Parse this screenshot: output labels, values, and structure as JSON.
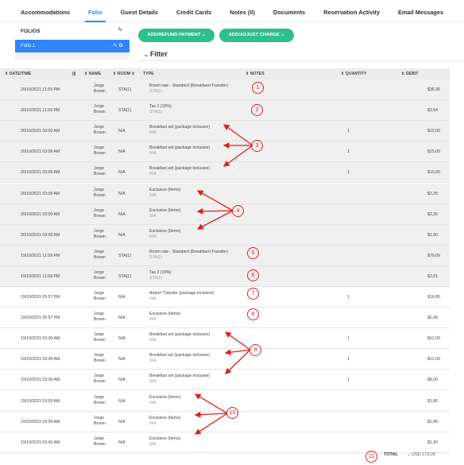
{
  "tabs": [
    {
      "label": "Accommodations",
      "active": false
    },
    {
      "label": "Folio",
      "active": true
    },
    {
      "label": "Guest Details",
      "active": false
    },
    {
      "label": "Credit Cards",
      "active": false
    },
    {
      "label": "Notes (0)",
      "active": false
    },
    {
      "label": "Documents",
      "active": false
    },
    {
      "label": "Reservation Activity",
      "active": false
    },
    {
      "label": "Email Messages",
      "active": false
    }
  ],
  "folios": {
    "title": "FOLIOS",
    "item": "Folio 1"
  },
  "buttons": {
    "refund": "ADD/REFUND PAYMENT",
    "adjust": "ADD/ADJUST CHARGE"
  },
  "filter": "Filter",
  "columns": {
    "datetime": "DATE/TIME",
    "name": "NAME",
    "room": "ROOM",
    "type": "TYPE",
    "notes": "NOTES",
    "quantity": "QUANTITY",
    "debit": "DEBIT"
  },
  "rows": [
    {
      "datetime": "20/10/2021 11:59 PM",
      "name1": "Jorge",
      "name2": "Brown",
      "room": "STA(1)",
      "type": "Room rate - Standard (Breakfast+Transfer)",
      "sub": "STA(1)",
      "qty": "",
      "debit": "$36,36",
      "bg": "grey"
    },
    {
      "datetime": "20/10/2021 11:59 PM",
      "name1": "Jorge",
      "name2": "Brown",
      "room": "STA(1)",
      "type": "Tax 2 (10%)",
      "sub": "STA(1)",
      "qty": "",
      "debit": "$3,64",
      "bg": "grey"
    },
    {
      "datetime": "20/10/2021 03:00 AM",
      "name1": "Jorge",
      "name2": "Brown",
      "room": "N/A",
      "type": "Breakfast set (package inclusive)",
      "sub": "N/A",
      "qty": "1",
      "debit": "$15,00",
      "bg": "grey"
    },
    {
      "datetime": "20/10/2021 03:00 AM",
      "name1": "Jorge",
      "name2": "Brown",
      "room": "N/A",
      "type": "Breakfast set (package inclusive)",
      "sub": "N/A",
      "qty": "1",
      "debit": "$15,00",
      "bg": "grey"
    },
    {
      "datetime": "20/10/2021 03:00 AM",
      "name1": "Jorge",
      "name2": "Brown",
      "room": "N/A",
      "type": "Breakfast set (package inclusive)",
      "sub": "N/A",
      "qty": "1",
      "debit": "$10,00",
      "bg": "grey"
    },
    {
      "datetime": "20/10/2021 03:00 AM",
      "name1": "Jorge",
      "name2": "Brown",
      "room": "N/A",
      "type": "Exclusive (Items)",
      "sub": "N/A",
      "qty": "",
      "debit": "$2,25",
      "bg": "grey"
    },
    {
      "datetime": "20/10/2021 03:00 AM",
      "name1": "Jorge",
      "name2": "Brown",
      "room": "N/A",
      "type": "Exclusive (Items)",
      "sub": "N/A",
      "qty": "",
      "debit": "$2,25",
      "bg": "grey"
    },
    {
      "datetime": "20/10/2021 03:00 AM",
      "name1": "Jorge",
      "name2": "Brown",
      "room": "N/A",
      "type": "Exclusive (Items)",
      "sub": "N/A",
      "qty": "",
      "debit": "$1,50",
      "bg": "grey"
    },
    {
      "datetime": "19/10/2021 11:59 PM",
      "name1": "Jorge",
      "name2": "Brown",
      "room": "STA(1)",
      "type": "Room rate - Standard (Breakfast+Transfer)",
      "sub": "STA(1)",
      "qty": "",
      "debit": "$79,09",
      "bg": "grey"
    },
    {
      "datetime": "19/10/2021 11:59 PM",
      "name1": "Jorge",
      "name2": "Brown",
      "room": "STA(1)",
      "type": "Tax 2 (10%)",
      "sub": "STA(1)",
      "qty": "",
      "debit": "$2,01",
      "bg": "grey"
    },
    {
      "datetime": "19/10/2021 05:57 PM",
      "name1": "Jorge",
      "name2": "Brown",
      "room": "N/A",
      "type": "Airport Transfer (package inclusive)",
      "sub": "N/A",
      "qty": "1",
      "debit": "$16,00",
      "bg": "white"
    },
    {
      "datetime": "19/10/2021 05:57 PM",
      "name1": "Jorge",
      "name2": "Brown",
      "room": "N/A",
      "type": "Exclusive (Items)",
      "sub": "N/A",
      "qty": "",
      "debit": "$2,40",
      "bg": "white"
    },
    {
      "datetime": "19/10/2021 03:00 AM",
      "name1": "Jorge",
      "name2": "Brown",
      "room": "N/A",
      "type": "Breakfast set (package inclusive)",
      "sub": "N/A",
      "qty": "1",
      "debit": "$12,00",
      "bg": "white"
    },
    {
      "datetime": "19/10/2021 03:00 AM",
      "name1": "Jorge",
      "name2": "Brown",
      "room": "N/A",
      "type": "Breakfast set (package inclusive)",
      "sub": "N/A",
      "qty": "1",
      "debit": "$12,00",
      "bg": "white"
    },
    {
      "datetime": "19/10/2021 03:00 AM",
      "name1": "Jorge",
      "name2": "Brown",
      "room": "N/A",
      "type": "Breakfast set (package inclusive)",
      "sub": "N/A",
      "qty": "1",
      "debit": "$8,00",
      "bg": "white"
    },
    {
      "datetime": "19/10/2021 03:00 AM",
      "name1": "Jorge",
      "name2": "Brown",
      "room": "N/A",
      "type": "Exclusive (Items)",
      "sub": "N/A",
      "qty": "",
      "debit": "$1,80",
      "bg": "white"
    },
    {
      "datetime": "19/10/2021 03:00 AM",
      "name1": "Jorge",
      "name2": "Brown",
      "room": "N/A",
      "type": "Exclusive (Items)",
      "sub": "N/A",
      "qty": "",
      "debit": "$1,80",
      "bg": "white"
    },
    {
      "datetime": "19/10/2021 03:00 AM",
      "name1": "Jorge",
      "name2": "Brown",
      "room": "N/A",
      "type": "Exclusive (Items)",
      "sub": "N/A",
      "qty": "",
      "debit": "$1,20",
      "bg": "white"
    }
  ],
  "callouts": [
    "1",
    "2",
    "3",
    "4",
    "5",
    "6",
    "7",
    "8",
    "9",
    "10",
    "11"
  ],
  "total": {
    "label": "TOTAL",
    "currency": "USD",
    "value": "173,20"
  },
  "colors": {
    "accent": "#2f86f6",
    "green": "#2fbf8f",
    "callout": "#e0201b"
  }
}
